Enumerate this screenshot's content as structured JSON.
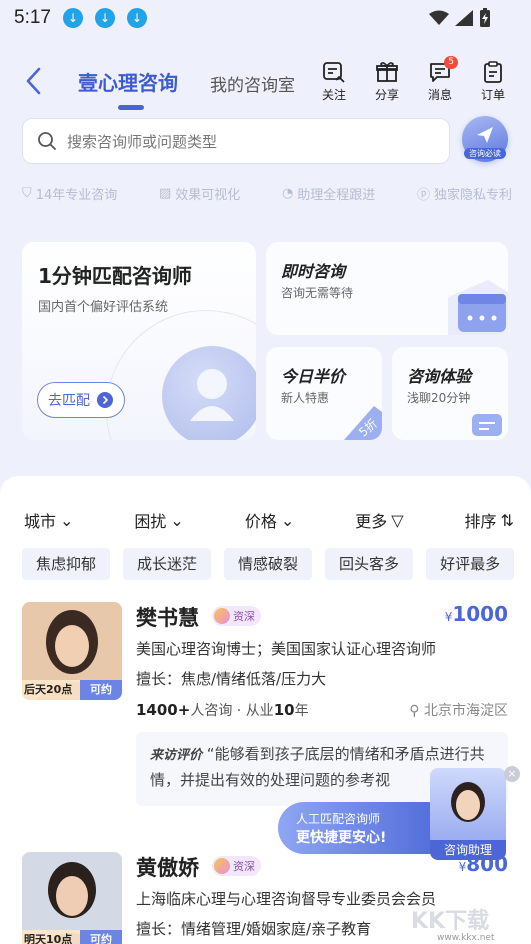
{
  "status_bar": {
    "time": "5:17"
  },
  "header": {
    "title": "壹心理咨询",
    "tab_my_room": "我的咨询室",
    "actions": [
      {
        "label": "关注",
        "icon": "follow-icon"
      },
      {
        "label": "分享",
        "icon": "gift-icon"
      },
      {
        "label": "消息",
        "icon": "message-icon",
        "badge": "5"
      },
      {
        "label": "订单",
        "icon": "order-icon"
      }
    ]
  },
  "search": {
    "placeholder": "搜索咨询师或问题类型",
    "must_read_label": "咨询必读"
  },
  "features": [
    "14年专业咨询",
    "效果可视化",
    "助理全程跟进",
    "独家隐私专利"
  ],
  "cards": {
    "match": {
      "title": "1分钟匹配咨询师",
      "subtitle": "国内首个偏好评估系统",
      "button": "去匹配"
    },
    "instant": {
      "title": "即时咨询",
      "subtitle": "咨询无需等待"
    },
    "half_price": {
      "title": "今日半价",
      "subtitle": "新人特惠",
      "badge": "5折"
    },
    "trial": {
      "title": "咨询体验",
      "subtitle": "浅聊20分钟"
    }
  },
  "filters": [
    {
      "label": "城市"
    },
    {
      "label": "困扰"
    },
    {
      "label": "价格"
    },
    {
      "label": "更多"
    },
    {
      "label": "排序"
    }
  ],
  "tags": [
    "焦虑抑郁",
    "成长迷茫",
    "情感破裂",
    "回头客多",
    "好评最多"
  ],
  "counselors": [
    {
      "name": "樊书慧",
      "level": "资深",
      "price_symbol": "¥",
      "price": "1000",
      "availability": "后天20点",
      "bookable": "可约",
      "credentials": "美国心理咨询博士；美国国家认证心理咨询师",
      "specialty": "擅长：焦虑/情绪低落/压力大",
      "consult_count": "1400+",
      "consult_unit": "人咨询",
      "years_prefix": "从业",
      "years": "10",
      "years_unit": "年",
      "location": "北京市海淀区",
      "review_label": "来访评价",
      "review": "“能够看到孩子底层的情绪和矛盾点进行共情，并提出有效的处理问题的参考视"
    },
    {
      "name": "黄傲娇",
      "level": "资深",
      "price_symbol": "¥",
      "price": "800",
      "availability": "明天10点",
      "bookable": "可约",
      "credentials": "上海临床心理与心理咨询督导专业委员会会员",
      "specialty": "擅长：情绪管理/婚姻家庭/亲子教育"
    }
  ],
  "assistant": {
    "line1": "人工匹配咨询师",
    "line2": "更快捷更安心!",
    "label": "咨询助理",
    "close": "×"
  },
  "watermark": {
    "site": "www.kkx.net",
    "brand": "KK下载"
  },
  "colors": {
    "accent": "#4a66dc",
    "badge_red": "#f04b3d",
    "background": "#eef1fb"
  }
}
